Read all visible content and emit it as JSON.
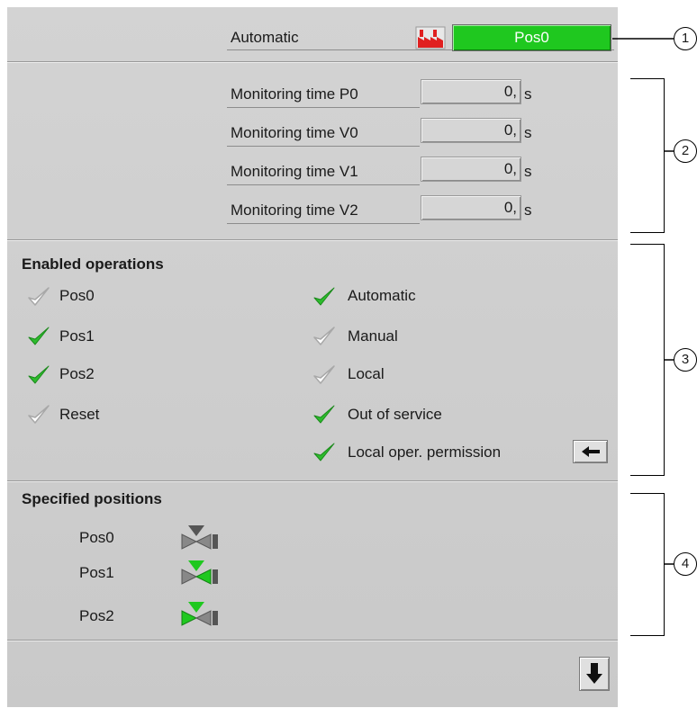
{
  "header": {
    "mode_label": "Automatic",
    "state_button": "Pos0",
    "factory_icon": "factory-icon"
  },
  "monitoring": {
    "unit": "s",
    "rows": [
      {
        "label": "Monitoring time P0",
        "value": "0,"
      },
      {
        "label": "Monitoring time V0",
        "value": "0,"
      },
      {
        "label": "Monitoring time V1",
        "value": "0,"
      },
      {
        "label": "Monitoring time V2",
        "value": "0,"
      }
    ]
  },
  "enabled_operations": {
    "title": "Enabled operations",
    "left": [
      {
        "label": "Pos0",
        "enabled": false
      },
      {
        "label": "Pos1",
        "enabled": true
      },
      {
        "label": "Pos2",
        "enabled": true
      },
      {
        "label": "Reset",
        "enabled": false
      }
    ],
    "right": [
      {
        "label": "Automatic",
        "enabled": true
      },
      {
        "label": "Manual",
        "enabled": false
      },
      {
        "label": "Local",
        "enabled": false
      },
      {
        "label": "Out of service",
        "enabled": true
      },
      {
        "label": "Local oper. permission",
        "enabled": true
      }
    ],
    "jump_icon": "arrow-left-icon"
  },
  "specified_positions": {
    "title": "Specified positions",
    "items": [
      {
        "label": "Pos0",
        "icon": "valve-pos0-icon"
      },
      {
        "label": "Pos1",
        "icon": "valve-pos1-icon"
      },
      {
        "label": "Pos2",
        "icon": "valve-pos2-icon"
      }
    ]
  },
  "footer": {
    "scroll_icon": "arrow-down-icon"
  },
  "callouts": [
    "1",
    "2",
    "3",
    "4"
  ],
  "colors": {
    "active_green": "#1fc81f",
    "panel_bg": "#cfcfcf",
    "check_green": "#2dbb2d",
    "check_gray": "#b0b0b0"
  }
}
